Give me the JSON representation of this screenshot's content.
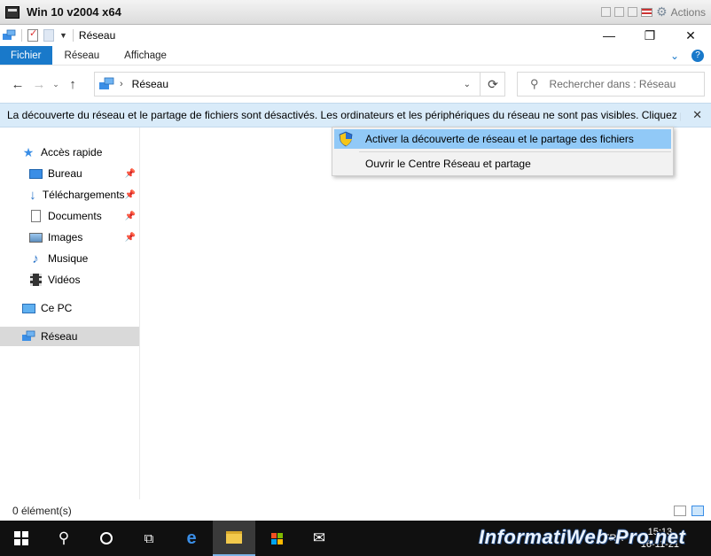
{
  "vm": {
    "title": "Win 10 v2004 x64",
    "actions_label": "Actions"
  },
  "window": {
    "title": "Réseau"
  },
  "ribbon": {
    "tabs": [
      "Fichier",
      "Réseau",
      "Affichage"
    ]
  },
  "address": {
    "path": "Réseau"
  },
  "search": {
    "placeholder": "Rechercher dans : Réseau"
  },
  "infobar": {
    "text": "La découverte du réseau et le partage de fichiers sont désactivés. Les ordinateurs et les périphériques du réseau ne sont pas visibles. Cliquez po..."
  },
  "context_menu": {
    "items": [
      "Activer la découverte de réseau et le partage des fichiers",
      "Ouvrir le Centre Réseau et partage"
    ]
  },
  "nav": {
    "quick_access": "Accès rapide",
    "pinned": [
      "Bureau",
      "Téléchargements",
      "Documents",
      "Images"
    ],
    "others": [
      "Musique",
      "Vidéos"
    ],
    "this_pc": "Ce PC",
    "network": "Réseau"
  },
  "status": {
    "count": "0 élément(s)"
  },
  "taskbar": {
    "lang": "FRA",
    "time": "15:13",
    "date": "16-11-21"
  },
  "watermark": "InformatiWeb-Pro.net",
  "colors": {
    "accent": "#1979ca",
    "infobar_bg": "#d9ebf9",
    "menu_highlight": "#91c9f7",
    "taskbar": "#101010"
  }
}
